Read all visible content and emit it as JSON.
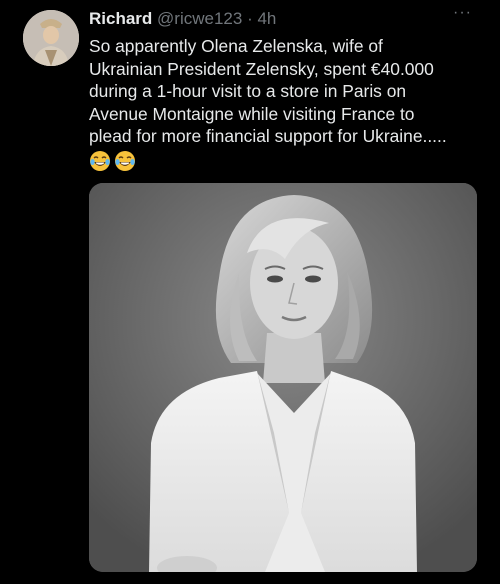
{
  "tweet": {
    "display_name": "Richard",
    "handle": "@ricwe123",
    "separator": "·",
    "time": "4h",
    "more_label": "···",
    "text_lines": [
      "So apparently Olena Zelenska, wife of",
      "Ukrainian President Zelensky, spent €40.000",
      "during a 1-hour visit to a store in Paris on",
      "Avenue Montaigne while visiting France to",
      "plead for more financial support for Ukraine....."
    ],
    "emojis": [
      "tears-of-joy-emoji",
      "tears-of-joy-emoji"
    ]
  },
  "colors": {
    "background": "#000000",
    "primary_text": "#e7e9ea",
    "secondary_text": "#71767b"
  }
}
